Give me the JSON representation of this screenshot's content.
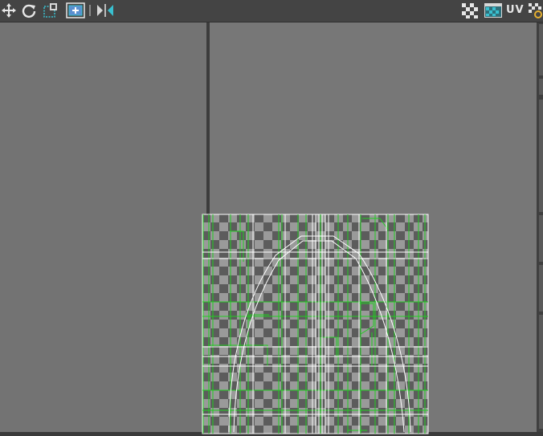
{
  "toolbar": {
    "uv_label": "UV",
    "left_tools": [
      "move-icon",
      "rotate-icon",
      "scale-icon",
      "uv-snapshot-icon",
      "flip-icon"
    ],
    "right_tools": [
      "checker-icon",
      "texture-display-icon",
      "uv-settings-icon"
    ]
  },
  "colors": {
    "toolbar_bg": "#444444",
    "viewport_bg": "#777777",
    "checker_light": "#9a9a9a",
    "checker_dark": "#5c5c5c",
    "uv_edge_green": "#22cc22",
    "uv_edge_white": "#ffffff",
    "accent_cyan": "#39c0d0"
  }
}
